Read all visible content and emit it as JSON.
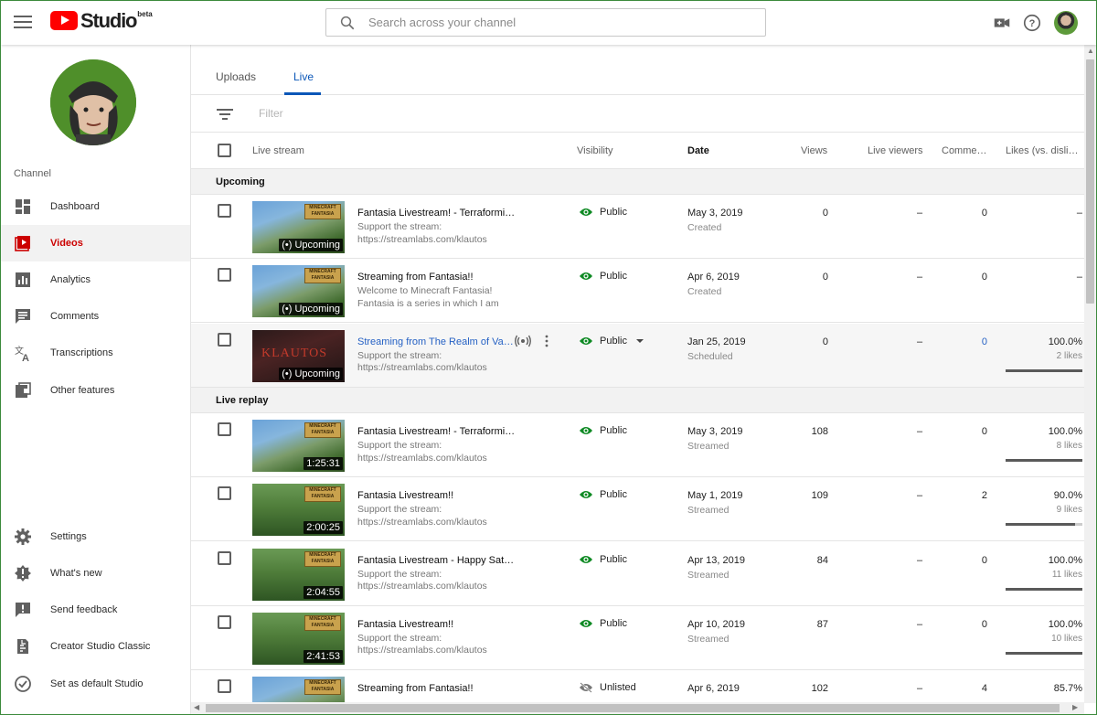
{
  "app": {
    "logo_text": "Studio",
    "logo_badge": "beta"
  },
  "search": {
    "placeholder": "Search across your channel"
  },
  "sidebar": {
    "channel_label": "Channel",
    "items": [
      {
        "label": "Dashboard",
        "icon": "dashboard-icon"
      },
      {
        "label": "Videos",
        "icon": "videos-icon",
        "active": true
      },
      {
        "label": "Analytics",
        "icon": "analytics-icon"
      },
      {
        "label": "Comments",
        "icon": "comments-icon"
      },
      {
        "label": "Transcriptions",
        "icon": "translate-icon"
      },
      {
        "label": "Other features",
        "icon": "other-features-icon"
      }
    ],
    "bottom_items": [
      {
        "label": "Settings",
        "icon": "gear-icon"
      },
      {
        "label": "What's new",
        "icon": "whats-new-icon"
      },
      {
        "label": "Send feedback",
        "icon": "feedback-icon"
      },
      {
        "label": "Creator Studio Classic",
        "icon": "classic-studio-icon"
      },
      {
        "label": "Set as default Studio",
        "icon": "check-circle-icon"
      }
    ]
  },
  "tabs": [
    {
      "label": "Uploads"
    },
    {
      "label": "Live",
      "active": true
    }
  ],
  "filter": {
    "placeholder": "Filter"
  },
  "columns": {
    "live_stream": "Live stream",
    "visibility": "Visibility",
    "date": "Date",
    "views": "Views",
    "live_viewers": "Live viewers",
    "comments": "Comme…",
    "likes": "Likes (vs. disli…"
  },
  "sections": {
    "upcoming": "Upcoming",
    "replay": "Live replay"
  },
  "upcoming_rows": [
    {
      "title": "Fantasia Livestream! - Terraformi…",
      "desc1": "Support the stream:",
      "desc2": "https://streamlabs.com/klautos",
      "badge": "(•) Upcoming",
      "visibility": "Public",
      "date": "May 3, 2019",
      "status": "Created",
      "views": "0",
      "live_viewers": "–",
      "comments": "0",
      "likes": "–",
      "likes_sub": ""
    },
    {
      "title": "Streaming from Fantasia!!",
      "desc1": "Welcome to Minecraft Fantasia!",
      "desc2": "Fantasia is a series in which I am",
      "badge": "(•) Upcoming",
      "visibility": "Public",
      "date": "Apr 6, 2019",
      "status": "Created",
      "views": "0",
      "live_viewers": "–",
      "comments": "0",
      "likes": "–",
      "likes_sub": ""
    },
    {
      "title": "Streaming from The Realm of Va…",
      "desc1": "Support the stream:",
      "desc2": "https://streamlabs.com/klautos",
      "badge": "(•) Upcoming",
      "thumb_text": "KLAUTOS",
      "visibility": "Public",
      "date": "Jan 25, 2019",
      "status": "Scheduled",
      "views": "0",
      "live_viewers": "–",
      "comments": "0",
      "likes": "100.0%",
      "likes_sub": "2 likes",
      "likes_ratio": 1.0
    }
  ],
  "replay_rows": [
    {
      "title": "Fantasia Livestream! - Terraformi…",
      "desc1": "Support the stream:",
      "desc2": "https://streamlabs.com/klautos",
      "badge": "1:25:31",
      "visibility": "Public",
      "date": "May 3, 2019",
      "status": "Streamed",
      "views": "108",
      "live_viewers": "–",
      "comments": "0",
      "likes": "100.0%",
      "likes_sub": "8 likes",
      "likes_ratio": 1.0
    },
    {
      "title": "Fantasia Livestream!!",
      "desc1": "Support the stream:",
      "desc2": "https://streamlabs.com/klautos",
      "badge": "2:00:25",
      "visibility": "Public",
      "date": "May 1, 2019",
      "status": "Streamed",
      "views": "109",
      "live_viewers": "–",
      "comments": "2",
      "likes": "90.0%",
      "likes_sub": "9 likes",
      "likes_ratio": 0.9
    },
    {
      "title": "Fantasia Livestream - Happy Sat…",
      "desc1": "Support the stream:",
      "desc2": "https://streamlabs.com/klautos",
      "badge": "2:04:55",
      "visibility": "Public",
      "date": "Apr 13, 2019",
      "status": "Streamed",
      "views": "84",
      "live_viewers": "–",
      "comments": "0",
      "likes": "100.0%",
      "likes_sub": "11 likes",
      "likes_ratio": 1.0
    },
    {
      "title": "Fantasia Livestream!!",
      "desc1": "Support the stream:",
      "desc2": "https://streamlabs.com/klautos",
      "badge": "2:41:53",
      "visibility": "Public",
      "date": "Apr 10, 2019",
      "status": "Streamed",
      "views": "87",
      "live_viewers": "–",
      "comments": "0",
      "likes": "100.0%",
      "likes_sub": "10 likes",
      "likes_ratio": 1.0
    },
    {
      "title": "Streaming from Fantasia!!",
      "desc1": "",
      "desc2": "",
      "badge": "",
      "visibility": "Unlisted",
      "date": "Apr 6, 2019",
      "status": "",
      "views": "102",
      "live_viewers": "–",
      "comments": "4",
      "likes": "85.7%",
      "likes_sub": "",
      "likes_ratio": 0.857
    }
  ],
  "colors": {
    "brand_red": "#ff0000",
    "accent_blue": "#0b57b8",
    "public_green": "#0f8a24"
  },
  "thumb_logo": "MINECRAFT FANTASIA"
}
